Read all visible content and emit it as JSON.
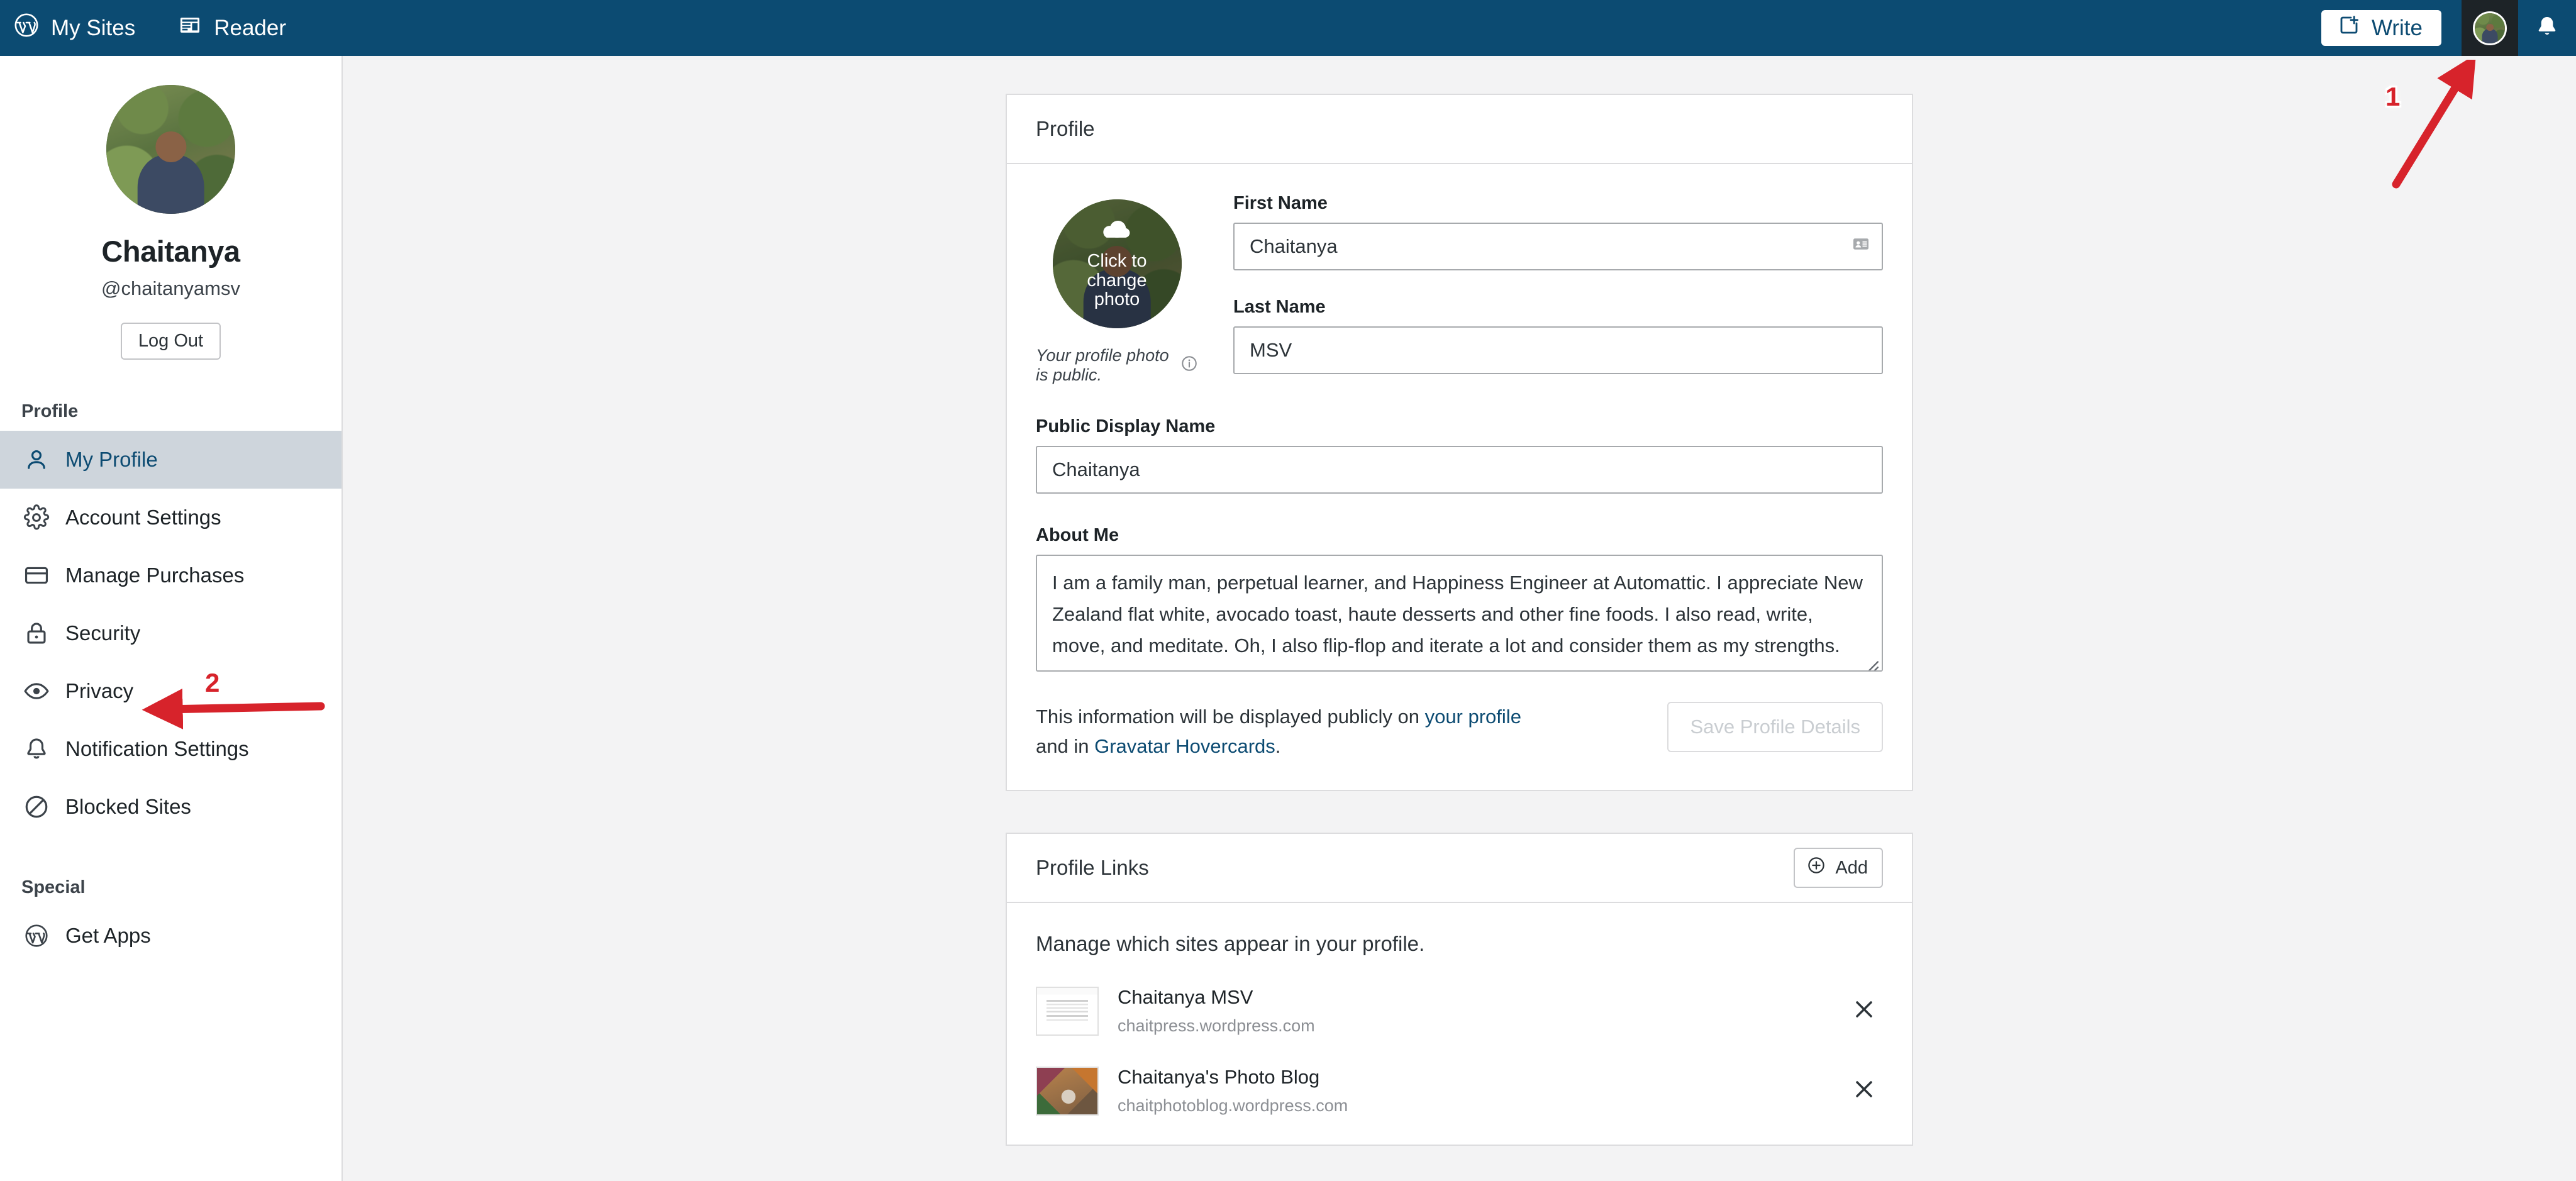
{
  "masthead": {
    "my_sites_label": "My Sites",
    "reader_label": "Reader",
    "write_label": "Write",
    "wordpress_icon": "wordpress-logo-icon",
    "reader_icon": "reader-icon",
    "write_icon": "write-post-icon",
    "avatar_icon": "user-avatar-icon",
    "bell_icon": "notifications-bell-icon",
    "background_color": "#0c4b72"
  },
  "sidebar": {
    "display_name": "Chaitanya",
    "handle": "@chaitanyamsv",
    "logout_label": "Log Out",
    "sections": [
      {
        "title": "Profile",
        "items": [
          {
            "label": "My Profile",
            "icon": "user-icon",
            "active": true
          },
          {
            "label": "Account Settings",
            "icon": "gear-icon",
            "active": false
          },
          {
            "label": "Manage Purchases",
            "icon": "credit-card-icon",
            "active": false
          },
          {
            "label": "Security",
            "icon": "lock-icon",
            "active": false
          },
          {
            "label": "Privacy",
            "icon": "eye-icon",
            "active": false
          },
          {
            "label": "Notification Settings",
            "icon": "bell-icon",
            "active": false
          },
          {
            "label": "Blocked Sites",
            "icon": "block-icon",
            "active": false
          }
        ]
      },
      {
        "title": "Special",
        "items": [
          {
            "label": "Get Apps",
            "icon": "wordpress-logo-icon",
            "active": false
          }
        ]
      }
    ],
    "active_highlight_color": "#ced5dc",
    "active_text_color": "#0c4b72"
  },
  "profile_card": {
    "header_title": "Profile",
    "photo_overlay_text": "Click to change photo",
    "photo_overlay_icon": "cloud-upload-icon",
    "photo_note": "Your profile photo is public.",
    "photo_note_icon": "info-icon",
    "fields": {
      "first_name_label": "First Name",
      "first_name_value": "Chaitanya",
      "first_name_autofill_icon": "contact-card-icon",
      "last_name_label": "Last Name",
      "last_name_value": "MSV",
      "display_name_label": "Public Display Name",
      "display_name_value": "Chaitanya",
      "about_me_label": "About Me",
      "about_me_value": "I am a family man, perpetual learner, and Happiness Engineer at Automattic. I appreciate New Zealand flat white, avocado toast, haute desserts and other fine foods. I also read, write, move, and meditate. Oh, I also flip-flop and iterate a lot and consider them as my strengths."
    },
    "footer": {
      "text_before": "This information will be displayed publicly on ",
      "link1": "your profile",
      "text_middle": " and in ",
      "link2": "Gravatar Hovercards",
      "text_after": ".",
      "save_label": "Save Profile Details",
      "save_disabled": true
    }
  },
  "profile_links_card": {
    "header_title": "Profile Links",
    "add_label": "Add",
    "add_icon": "plus-circle-icon",
    "intro": "Manage which sites appear in your profile.",
    "items": [
      {
        "title": "Chaitanya MSV",
        "url": "chaitpress.wordpress.com",
        "thumb": "text",
        "remove_icon": "close-x-icon"
      },
      {
        "title": "Chaitanya's Photo Blog",
        "url": "chaitphotoblog.wordpress.com",
        "thumb": "photo",
        "remove_icon": "close-x-icon"
      }
    ]
  },
  "annotations": {
    "color": "#d7232b",
    "markers": [
      {
        "number": "1",
        "target": "avatar-button"
      },
      {
        "number": "2",
        "target": "sidebar-item-security"
      }
    ]
  }
}
